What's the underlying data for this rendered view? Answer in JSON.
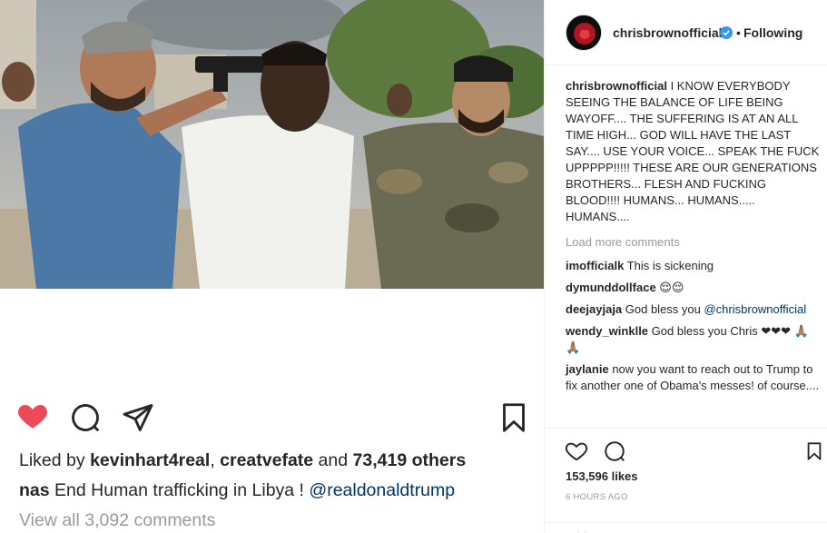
{
  "post": {
    "image_alt": "Photo of a man in white shirt held at gunpoint by two men",
    "liked_prefix": "Liked by ",
    "liked_user": "kevinhart4real",
    "liked_sep": ", ",
    "liked_user2": "creatvefate",
    "liked_mid": " and ",
    "liked_count": "73,419 others",
    "caption_user": "nas",
    "caption_text": " End Human trafficking in Libya ! ",
    "caption_mention": "@realdonaldtrump",
    "view_all": "View all 3,092 comments"
  },
  "header": {
    "username": "chrisbrownofficial",
    "dot": "•",
    "follow_state": "Following"
  },
  "comments": {
    "main_user": "chrisbrownofficial",
    "main_text": " I KNOW EVERYBODY SEEING THE BALANCE OF LIFE BEING WAYOFF.... THE SUFFERING IS AT AN ALL TIME HIGH... GOD WILL HAVE THE LAST SAY.... USE YOUR VOICE... SPEAK THE FUCK UPPPPP!!!!! THESE ARE OUR GENERATIONS BROTHERS... FLESH AND FUCKING BLOOD!!!! HUMANS... HUMANS..... HUMANS....",
    "load_more": "Load more comments",
    "items": [
      {
        "user": "imofficialk",
        "text": " This is sickening"
      },
      {
        "user": "dymunddollface",
        "text": " 😌😌"
      },
      {
        "user": "deejayjaja",
        "text": " God bless you ",
        "mention": "@chrisbrownofficial"
      },
      {
        "user": "wendy_winklle",
        "text": " God bless you Chris ❤❤❤ 🙏🏽🙏🏽"
      },
      {
        "user": "jaylanie",
        "text": " now you want to reach out to Trump to fix another one of Obama's messes! of course...."
      }
    ]
  },
  "right_footer": {
    "likes": "153,596 likes",
    "time": "6 HOURS AGO",
    "add_comment": "Add a comment..."
  },
  "colors": {
    "heart": "#ed4956",
    "verified": "#3897f0",
    "muted": "#999999",
    "text": "#262626"
  }
}
